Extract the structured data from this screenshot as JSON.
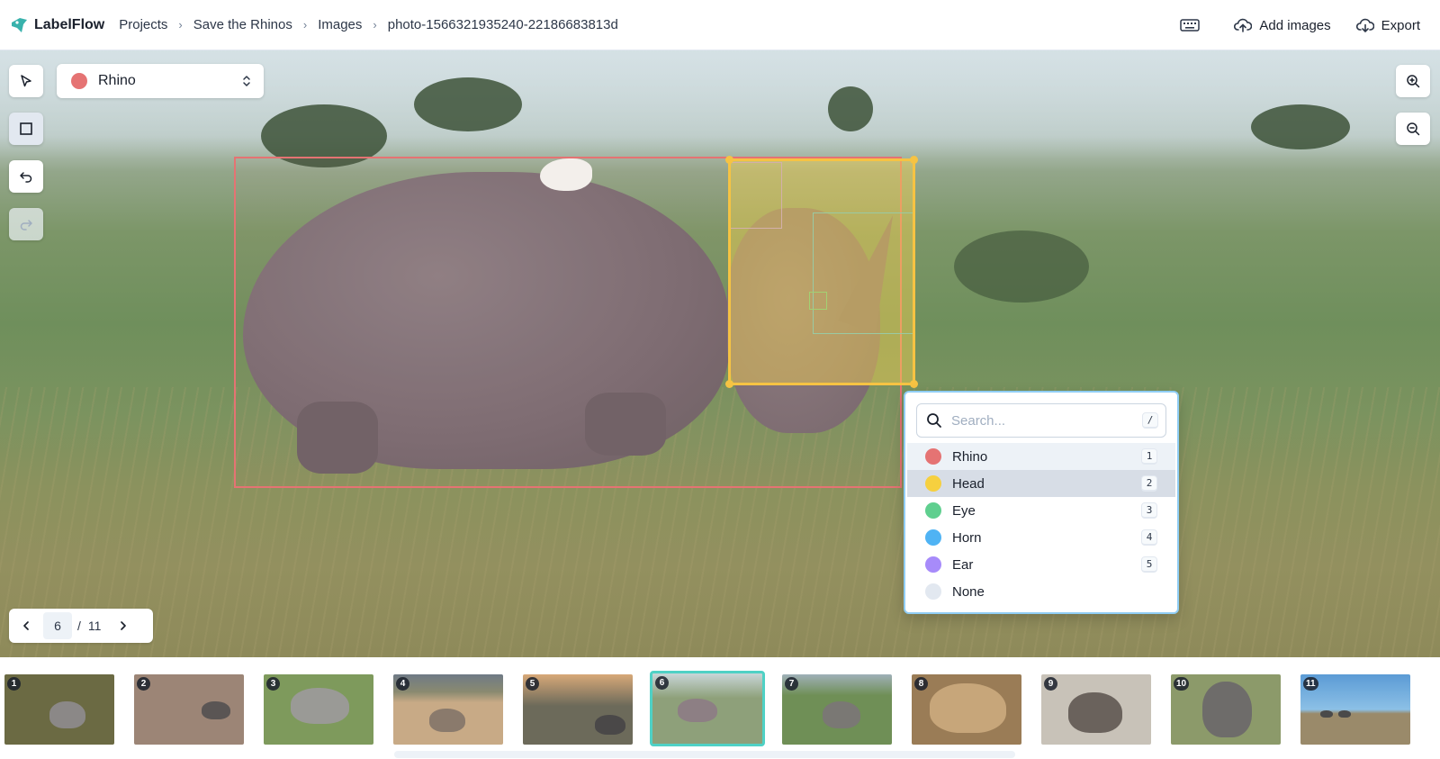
{
  "app": {
    "name": "LabelFlow"
  },
  "breadcrumbs": [
    "Projects",
    "Save the Rhinos",
    "Images",
    "photo-1566321935240-22186683813d"
  ],
  "header_actions": {
    "add_images": "Add images",
    "export": "Export"
  },
  "toolbar": {
    "selected_class": "Rhino",
    "selected_class_color": "#e57373"
  },
  "class_popover": {
    "search_placeholder": "Search...",
    "search_shortcut": "/",
    "options": [
      {
        "name": "Rhino",
        "shortcut": "1",
        "color": "#e57373"
      },
      {
        "name": "Head",
        "shortcut": "2",
        "color": "#f6d03f"
      },
      {
        "name": "Eye",
        "shortcut": "3",
        "color": "#5fcf8f"
      },
      {
        "name": "Horn",
        "shortcut": "4",
        "color": "#4fb3f4"
      },
      {
        "name": "Ear",
        "shortcut": "5",
        "color": "#a78bfa"
      },
      {
        "name": "None",
        "shortcut": "",
        "color": "#e2e8f0"
      }
    ]
  },
  "pagination": {
    "current": "6",
    "separator": "/",
    "total": "11"
  },
  "gallery": [
    {
      "number": "1",
      "bg": "#6b6a43",
      "animal": "#8b8887"
    },
    {
      "number": "2",
      "bg": "#9c8576",
      "animal": "#5a5554"
    },
    {
      "number": "3",
      "bg": "#7e9a5c",
      "animal": "#9a9a96"
    },
    {
      "number": "4",
      "bg": "#c8aa86",
      "animal": "#8a7a6c"
    },
    {
      "number": "5",
      "bg": "#6c6a5a",
      "animal": "#4a4848"
    },
    {
      "number": "6",
      "bg": "#8ea07a",
      "animal": "#8d7f84"
    },
    {
      "number": "7",
      "bg": "#6f8f56",
      "animal": "#7a7874"
    },
    {
      "number": "8",
      "bg": "#9a7c56",
      "animal": "#c7a67a"
    },
    {
      "number": "9",
      "bg": "#c8c2b8",
      "animal": "#6a625c"
    },
    {
      "number": "10",
      "bg": "#8c9a6a",
      "animal": "#6e6c6a"
    },
    {
      "number": "11",
      "bg": "#5b9bd5",
      "animal": "#4a4a4a"
    }
  ]
}
